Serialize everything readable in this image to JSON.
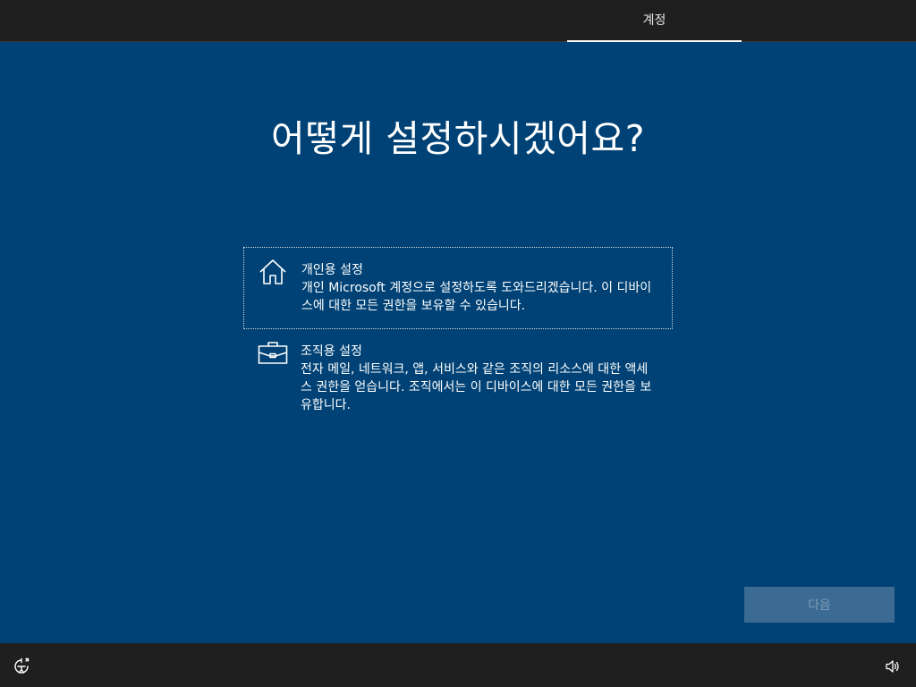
{
  "topbar": {
    "tab_label": "계정"
  },
  "main": {
    "heading": "어떻게 설정하시겠어요?",
    "options": [
      {
        "title": "개인용 설정",
        "description": "개인 Microsoft 계정으로 설정하도록 도와드리겠습니다. 이 디바이스에 대한 모든 권한을 보유할 수 있습니다.",
        "icon": "home-icon",
        "selected": true
      },
      {
        "title": "조직용 설정",
        "description": "전자 메일, 네트워크, 앱, 서비스와 같은 조직의 리소스에 대한 액세스 권한을 얻습니다. 조직에서는 이 디바이스에 대한 모든 권한을 보유합니다.",
        "icon": "briefcase-icon",
        "selected": false
      }
    ],
    "next_label": "다음"
  },
  "bottombar": {
    "left_icon": "ease-of-access-icon",
    "right_icon": "volume-icon"
  },
  "colors": {
    "background": "#004275",
    "topbar": "#1f1f1f",
    "button_disabled": "#3b6a92",
    "button_text_disabled": "#7e9bb8"
  }
}
